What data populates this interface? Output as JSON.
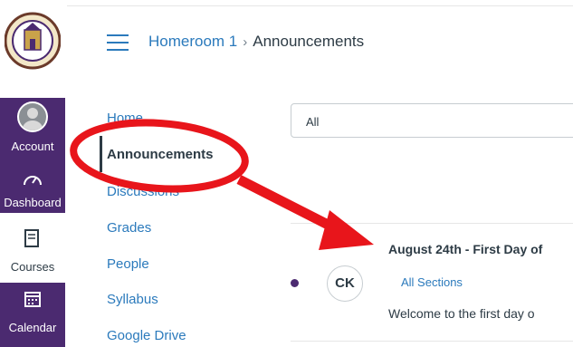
{
  "global_nav": {
    "account_label": "Account",
    "dashboard_label": "Dashboard",
    "courses_label": "Courses",
    "calendar_label": "Calendar"
  },
  "header": {
    "course_link": "Homeroom 1",
    "separator": "›",
    "current_page": "Announcements"
  },
  "course_nav": {
    "items": [
      "Home",
      "Announcements",
      "Discussions",
      "Grades",
      "People",
      "Syllabus",
      "Google Drive"
    ],
    "active": "Announcements"
  },
  "filter": {
    "value": "All"
  },
  "announcement": {
    "author_initials": "CK",
    "title": "August 24th - First Day of",
    "sections": "All Sections",
    "preview": "Welcome to the first day o"
  },
  "colors": {
    "brand_purple": "#4b2a70",
    "link_blue": "#2b7abc",
    "annotation_red": "#e8151b"
  },
  "icons": [
    "hamburger-icon",
    "avatar-icon",
    "dashboard-icon",
    "courses-icon",
    "calendar-icon"
  ]
}
